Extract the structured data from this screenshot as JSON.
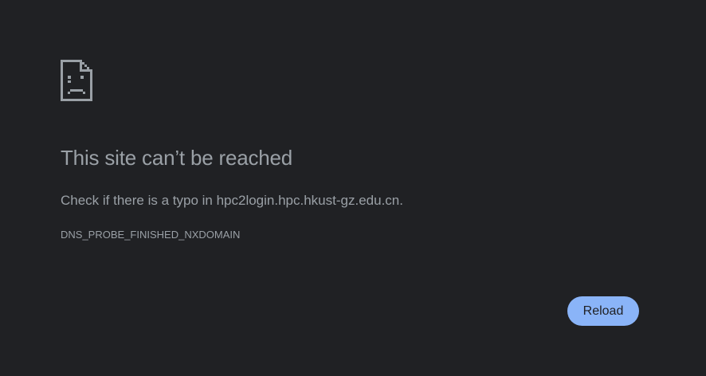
{
  "error_page": {
    "icon": "sad-page-icon",
    "title": "This site can’t be reached",
    "description": "Check if there is a typo in hpc2login.hpc.hkust-gz.edu.cn.",
    "error_code": "DNS_PROBE_FINISHED_NXDOMAIN",
    "reload_label": "Reload"
  },
  "colors": {
    "background": "#202124",
    "text": "#9aa0a6",
    "accent": "#8ab4f8"
  }
}
